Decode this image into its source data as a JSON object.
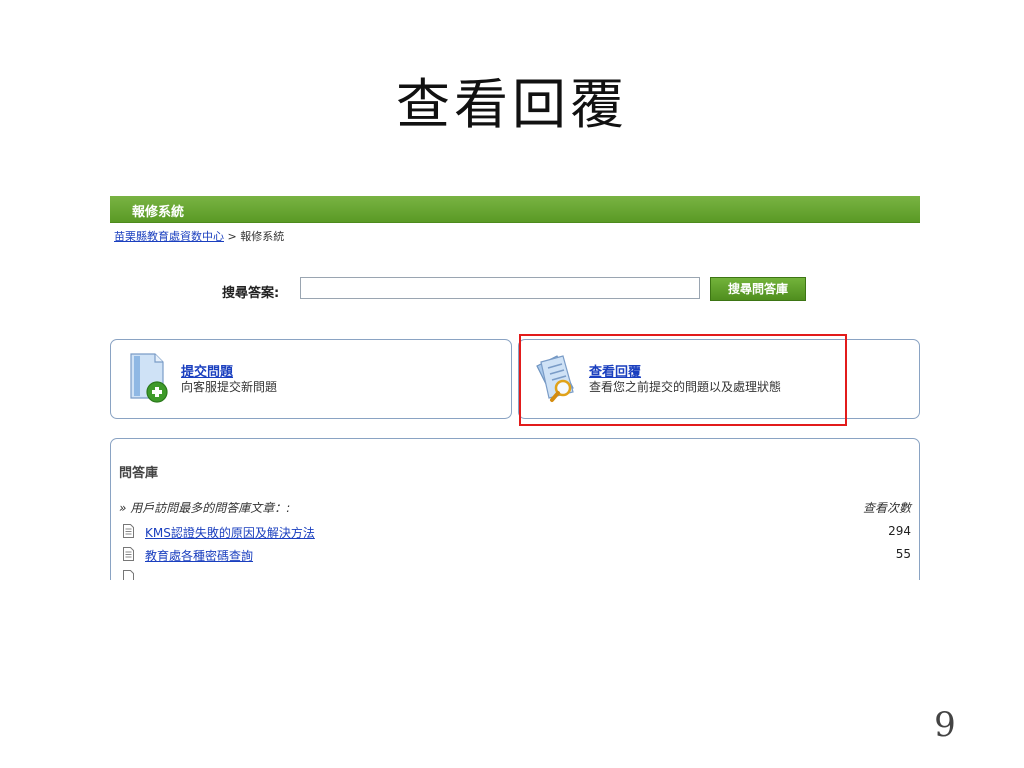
{
  "slide": {
    "title": "查看回覆",
    "page_number": "9"
  },
  "app": {
    "header_title": "報修系統",
    "breadcrumb": {
      "home_link": "苗栗縣教育處資数中心",
      "separator": ">",
      "current": "報修系統"
    }
  },
  "search": {
    "label": "搜尋答案:",
    "value": "",
    "placeholder": "",
    "button_label": "搜尋問答庫"
  },
  "actions": [
    {
      "title": "提交問題",
      "description": "向客服提交新問題",
      "icon": "document-add-icon"
    },
    {
      "title": "查看回覆",
      "description": "查看您之前提交的問題以及處理狀態",
      "icon": "document-search-icon"
    }
  ],
  "knowledge_base": {
    "title": "問答庫",
    "subtitle": "» 用戶訪問最多的問答庫文章：:",
    "column_header": "查看次數",
    "articles": [
      {
        "title": "KMS認證失敗的原因及解決方法",
        "views": "294"
      },
      {
        "title": "教育處各種密碼查詢",
        "views": "55"
      }
    ]
  },
  "colors": {
    "header_green": "#5a9a25",
    "link_blue": "#1a3fbf",
    "highlight_red": "#e21b1b",
    "panel_border": "#8aa3c3"
  }
}
